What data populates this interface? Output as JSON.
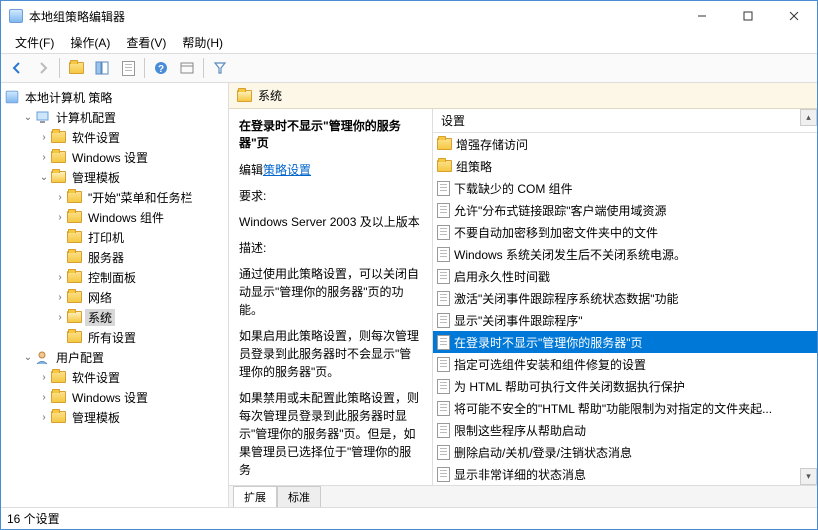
{
  "window": {
    "title": "本地组策略编辑器"
  },
  "menu": {
    "file": "文件(F)",
    "action": "操作(A)",
    "view": "查看(V)",
    "help": "帮助(H)"
  },
  "tree": {
    "root": "本地计算机 策略",
    "computer_config": "计算机配置",
    "software_settings": "软件设置",
    "windows_settings": "Windows 设置",
    "admin_templates": "管理模板",
    "start_taskbar": "\"开始\"菜单和任务栏",
    "windows_components": "Windows 组件",
    "printers": "打印机",
    "servers": "服务器",
    "control_panel": "控制面板",
    "network": "网络",
    "system": "系统",
    "all_settings": "所有设置",
    "user_config": "用户配置",
    "u_software_settings": "软件设置",
    "u_windows_settings": "Windows 设置",
    "u_admin_templates": "管理模板"
  },
  "right": {
    "header": "系统",
    "setting_title": "在登录时不显示\"管理你的服务器\"页",
    "edit_prefix": "编辑",
    "edit_link": "策略设置",
    "req_label": "要求:",
    "req_text": "Windows Server 2003 及以上版本",
    "desc_label": "描述:",
    "desc1": "通过使用此策略设置，可以关闭自动显示\"管理你的服务器\"页的功能。",
    "desc2": "如果启用此策略设置，则每次管理员登录到此服务器时不会显示\"管理你的服务器\"页。",
    "desc3": "如果禁用或未配置此策略设置，则每次管理员登录到此服务器时显示\"管理你的服务器\"页。但是，如果管理员已选择位于\"管理你的服务"
  },
  "list": {
    "header": "设置",
    "items": [
      "增强存储访问",
      "组策略",
      "下载缺少的 COM 组件",
      "允许\"分布式链接跟踪\"客户端使用域资源",
      "不要自动加密移到加密文件夹中的文件",
      "Windows 系统关闭发生后不关闭系统电源。",
      "启用永久性时间戳",
      "激活\"关闭事件跟踪程序系统状态数据\"功能",
      "显示\"关闭事件跟踪程序\"",
      "在登录时不显示\"管理你的服务器\"页",
      "指定可选组件安装和组件修复的设置",
      "为 HTML 帮助可执行文件关闭数据执行保护",
      "将可能不安全的\"HTML 帮助\"功能限制为对指定的文件夹起...",
      "限制这些程序从帮助启动",
      "删除启动/关机/登录/注销状态消息",
      "显示非常详细的状态消息"
    ],
    "selected_index": 9,
    "folder_rows": [
      0,
      1
    ]
  },
  "tabs": {
    "extended": "扩展",
    "standard": "标准"
  },
  "statusbar": "16 个设置"
}
